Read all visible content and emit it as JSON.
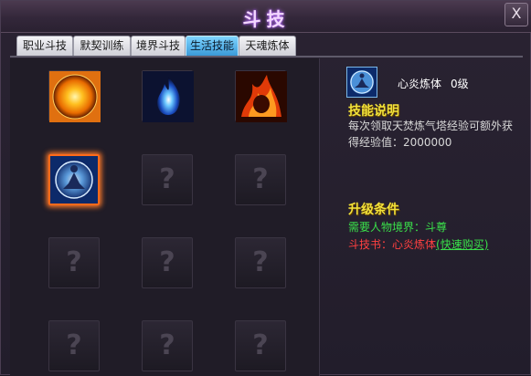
{
  "window": {
    "title": "斗技",
    "close_glyph": "X"
  },
  "tabs": [
    {
      "label": "职业斗技",
      "active": false
    },
    {
      "label": "默契训练",
      "active": false
    },
    {
      "label": "境界斗技",
      "active": false
    },
    {
      "label": "生活技能",
      "active": true
    },
    {
      "label": "天魂炼体",
      "active": false
    }
  ],
  "skills": [
    {
      "icon": "orange-orb-icon",
      "state": "unlocked"
    },
    {
      "icon": "blue-flame-icon",
      "state": "unlocked"
    },
    {
      "icon": "fire-demon-icon",
      "state": "unlocked"
    },
    {
      "icon": "meditation-icon",
      "state": "selected"
    },
    {
      "icon": "locked-slot-icon",
      "state": "locked",
      "glyph": "?"
    },
    {
      "icon": "locked-slot-icon",
      "state": "locked",
      "glyph": "?"
    },
    {
      "icon": "locked-slot-icon",
      "state": "locked",
      "glyph": "?"
    },
    {
      "icon": "locked-slot-icon",
      "state": "locked",
      "glyph": "?"
    },
    {
      "icon": "locked-slot-icon",
      "state": "locked",
      "glyph": "?"
    },
    {
      "icon": "locked-slot-icon",
      "state": "locked",
      "glyph": "?"
    },
    {
      "icon": "locked-slot-icon",
      "state": "locked",
      "glyph": "?"
    },
    {
      "icon": "locked-slot-icon",
      "state": "locked",
      "glyph": "?"
    }
  ],
  "detail": {
    "name": "心炎炼体",
    "level": "0级",
    "desc_heading": "技能说明",
    "desc_line1": "每次领取天焚炼气塔经验可额外获",
    "desc_line2": "得经验值：2000000",
    "upgrade_heading": "升级条件",
    "req_realm": "需要人物境界：斗尊",
    "req_book_prefix": "斗技书：心炎炼体",
    "req_book_link": "(快速购买)"
  },
  "colors": {
    "accent_yellow": "#f2e23a",
    "req_green": "#3ae04a",
    "req_red": "#ff4040",
    "active_tab": "#3a9ad8"
  }
}
